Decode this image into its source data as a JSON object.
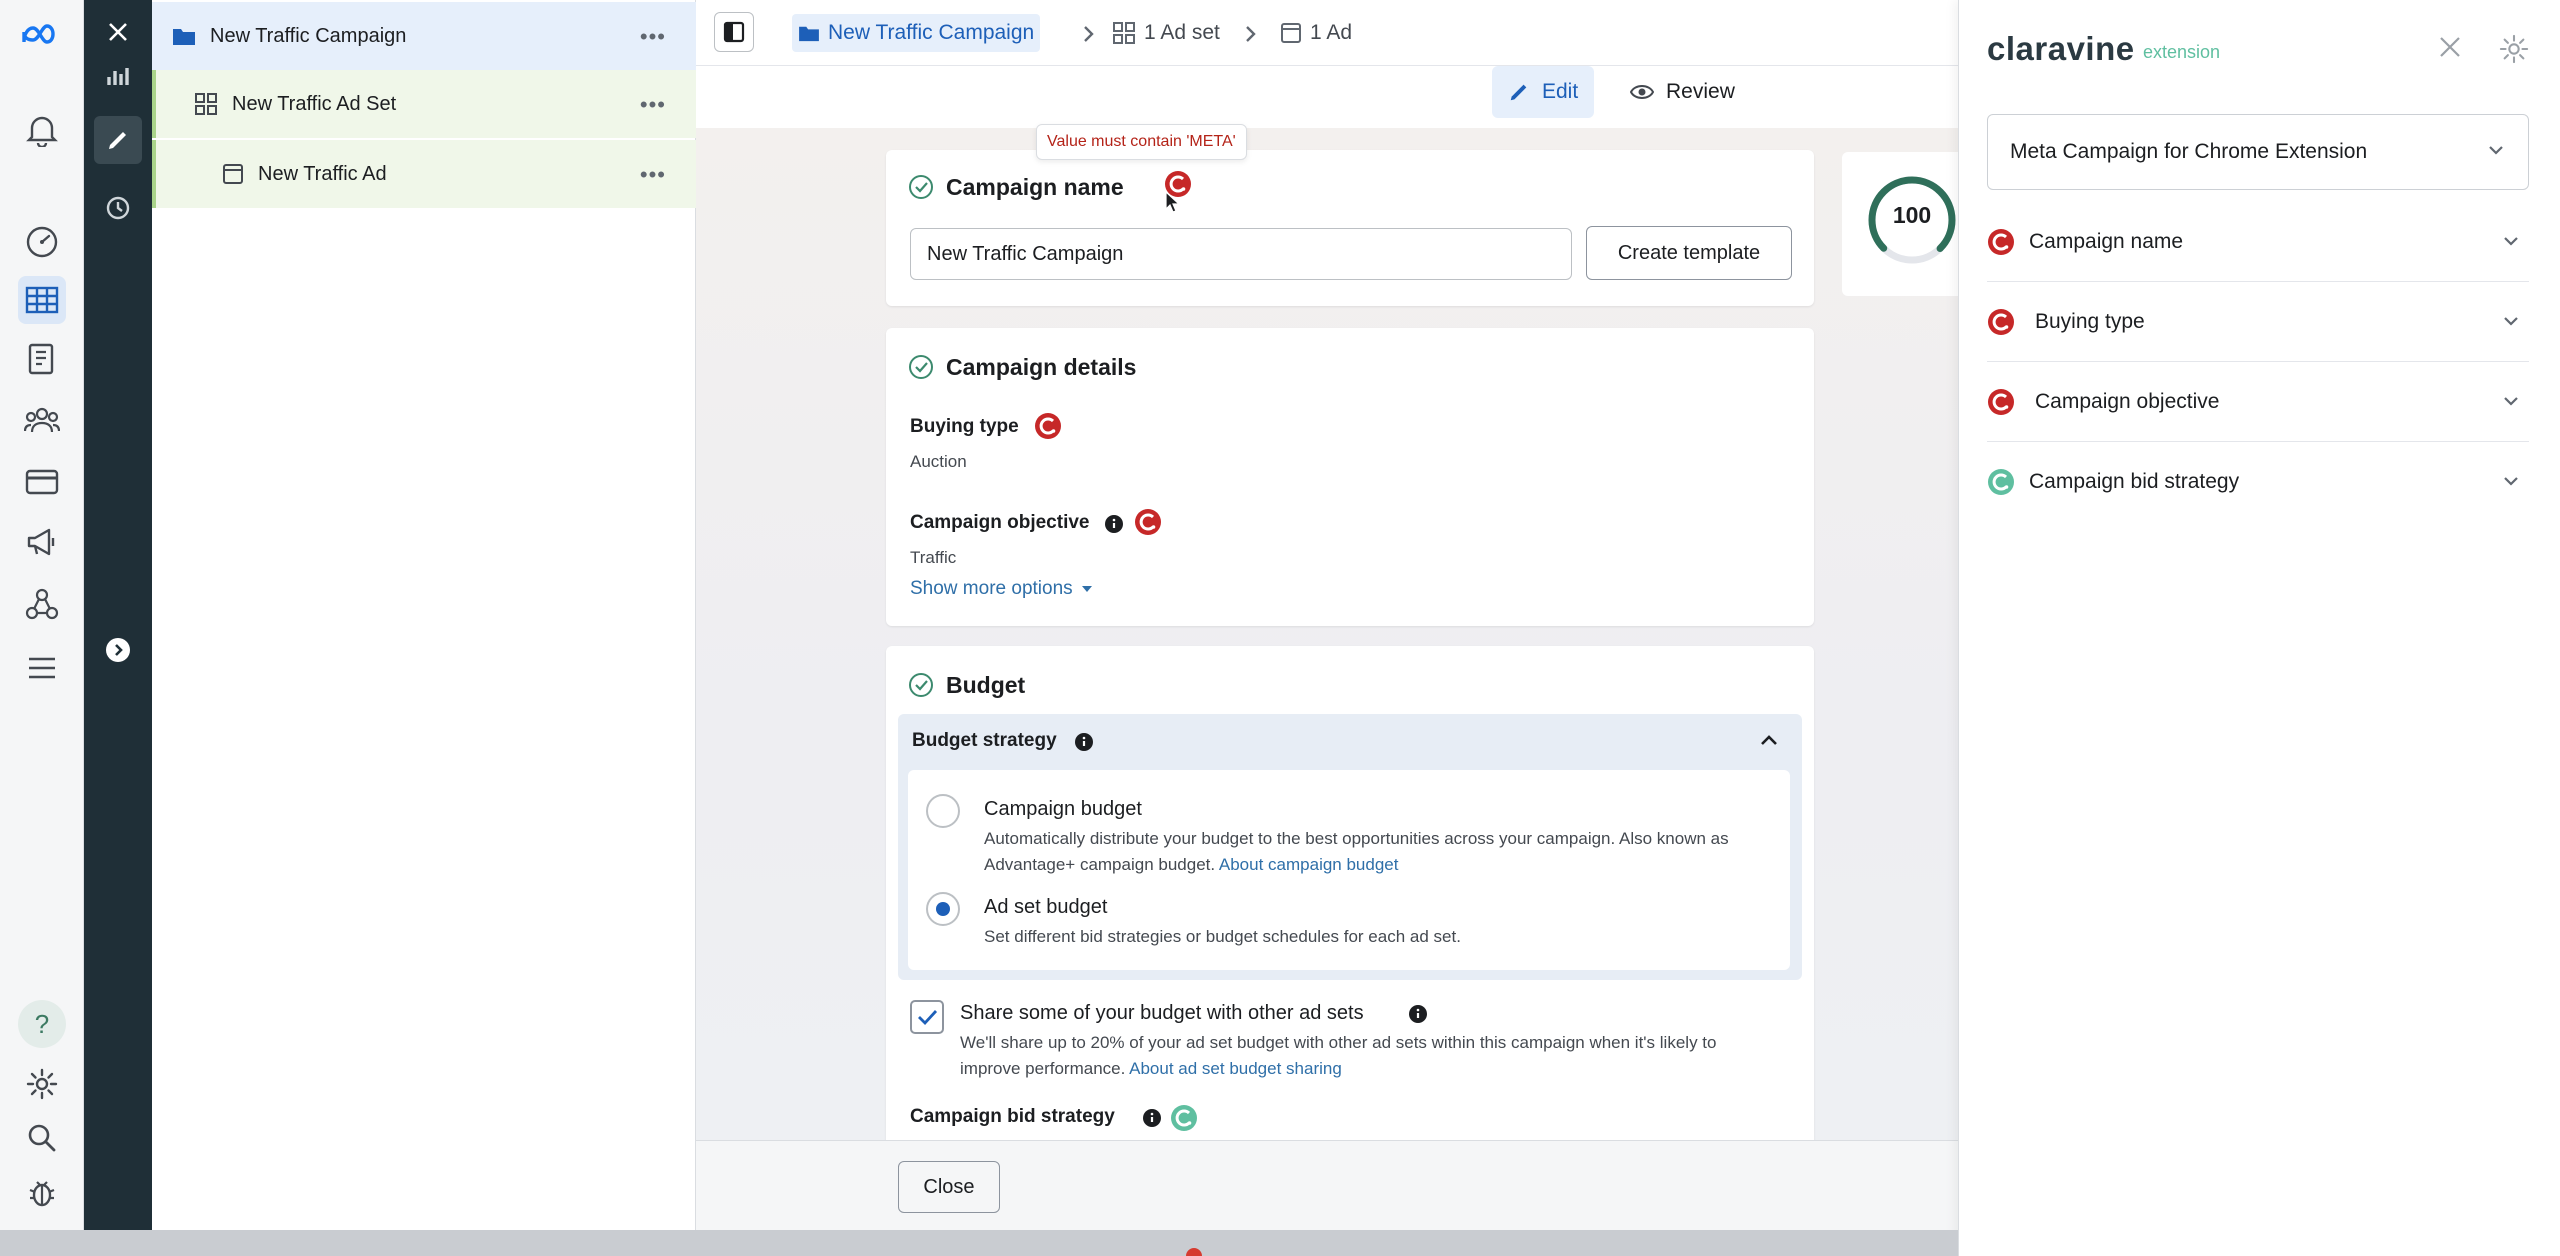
{
  "colors": {
    "accent_blue": "#1d5fb8",
    "link_blue": "#2f6fa8",
    "error_red": "#c62828",
    "success_green": "#5fbfa0",
    "tree_green": "#f0f7e9"
  },
  "rail": {
    "icons": [
      "meta-logo-icon",
      "bell-icon",
      "gauge-icon",
      "table-icon",
      "book-icon",
      "people-icon",
      "card-icon",
      "megaphone-icon",
      "network-icon",
      "menu-icon",
      "help-icon",
      "gear-icon",
      "search-icon",
      "bug-icon"
    ],
    "help_label": "?"
  },
  "strip": {
    "icons": [
      "close-icon",
      "chart-icon",
      "pencil-icon",
      "clock-icon",
      "chevron-right-icon"
    ]
  },
  "tree": {
    "items": [
      {
        "label": "New Traffic Campaign",
        "more": "•••"
      },
      {
        "label": "New Traffic Ad Set",
        "more": "•••"
      },
      {
        "label": "New Traffic Ad",
        "more": "•••"
      }
    ]
  },
  "topbar": {
    "crumbs": [
      "New Traffic Campaign",
      "1 Ad set",
      "1 Ad"
    ]
  },
  "subbar": {
    "edit_label": "Edit",
    "review_label": "Review"
  },
  "tooltip": {
    "text": "Value must contain 'META'"
  },
  "campaign_name": {
    "title": "Campaign name",
    "value": "New Traffic Campaign",
    "create_template": "Create template"
  },
  "score": {
    "value": "100",
    "progress": 1.0
  },
  "campaign_details": {
    "title": "Campaign details",
    "buying_type_label": "Buying type",
    "buying_type_value": "Auction",
    "objective_label": "Campaign objective",
    "objective_value": "Traffic",
    "show_more": "Show more options"
  },
  "budget": {
    "title": "Budget",
    "strategy_label": "Budget strategy",
    "campaign_budget_title": "Campaign budget",
    "campaign_budget_desc": "Automatically distribute your budget to the best opportunities across your campaign. Also known as Advantage+ campaign budget.",
    "campaign_budget_link": "About campaign budget",
    "adset_budget_title": "Ad set budget",
    "adset_budget_desc": "Set different bid strategies or budget schedules for each ad set.",
    "share_label": "Share some of your budget with other ad sets",
    "share_desc": "We'll share up to 20% of your ad set budget with other ad sets within this campaign when it's likely to improve performance.",
    "share_link": "About ad set budget sharing",
    "bid_strategy_label": "Campaign bid strategy"
  },
  "footer": {
    "close_label": "Close"
  },
  "extension": {
    "brand": "claravine",
    "brand_sub": "extension",
    "select_value": "Meta Campaign for Chrome Extension",
    "rows": [
      {
        "label": "Campaign name",
        "status": "error"
      },
      {
        "label": "Buying type",
        "status": "error"
      },
      {
        "label": "Campaign objective",
        "status": "error"
      },
      {
        "label": "Campaign bid strategy",
        "status": "ok"
      }
    ]
  }
}
